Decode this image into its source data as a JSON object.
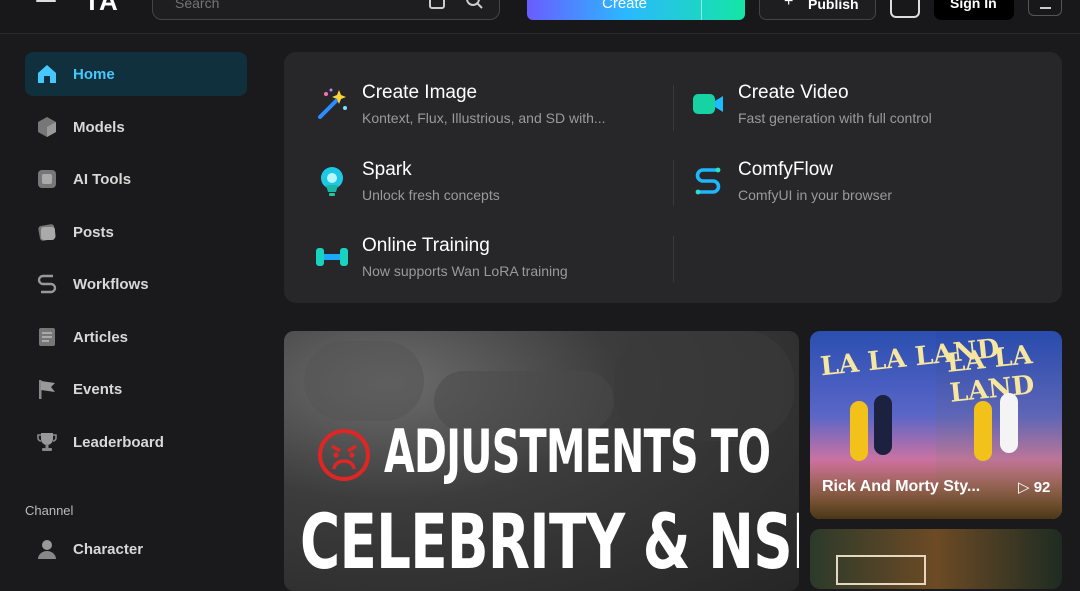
{
  "header": {
    "logo": "TA",
    "search_placeholder": "Search",
    "create_label": "Create",
    "publish_label": "Publish",
    "signin_label": "Sign In"
  },
  "sidebar": {
    "items": [
      {
        "label": "Home",
        "icon": "home-icon"
      },
      {
        "label": "Models",
        "icon": "cube-icon"
      },
      {
        "label": "AI Tools",
        "icon": "tools-icon"
      },
      {
        "label": "Posts",
        "icon": "posts-icon"
      },
      {
        "label": "Workflows",
        "icon": "workflow-icon"
      },
      {
        "label": "Articles",
        "icon": "article-icon"
      },
      {
        "label": "Events",
        "icon": "flag-icon"
      },
      {
        "label": "Leaderboard",
        "icon": "trophy-icon"
      }
    ],
    "channel_title": "Channel",
    "channel_items": [
      {
        "label": "Character",
        "icon": "character-icon"
      }
    ]
  },
  "quick": [
    {
      "title": "Create Image",
      "sub": "Kontext, Flux, Illustrious, and SD with...",
      "icon": "magic-wand-icon"
    },
    {
      "title": "Create Video",
      "sub": "Fast generation with full control",
      "icon": "video-camera-icon"
    },
    {
      "title": "Spark",
      "sub": "Unlock fresh concepts",
      "icon": "lightbulb-icon"
    },
    {
      "title": "ComfyFlow",
      "sub": "ComfyUI in your browser",
      "icon": "comfyflow-icon"
    },
    {
      "title": "Online Training",
      "sub": "Now supports Wan LoRA training",
      "icon": "dumbbell-icon"
    }
  ],
  "banner": {
    "line1": "ADJUSTMENTS TO",
    "line2": "CELEBRITY & NSFW"
  },
  "poster": {
    "title_left": "LA LA LAND",
    "title_right": "LA LA LAND",
    "name": "Rick And Morty Sty...",
    "views": "92"
  },
  "colors": {
    "accent": "#46c8ff",
    "active_bg": "#10303d",
    "card_bg": "#27272a",
    "page_bg": "#1a1a1c"
  }
}
